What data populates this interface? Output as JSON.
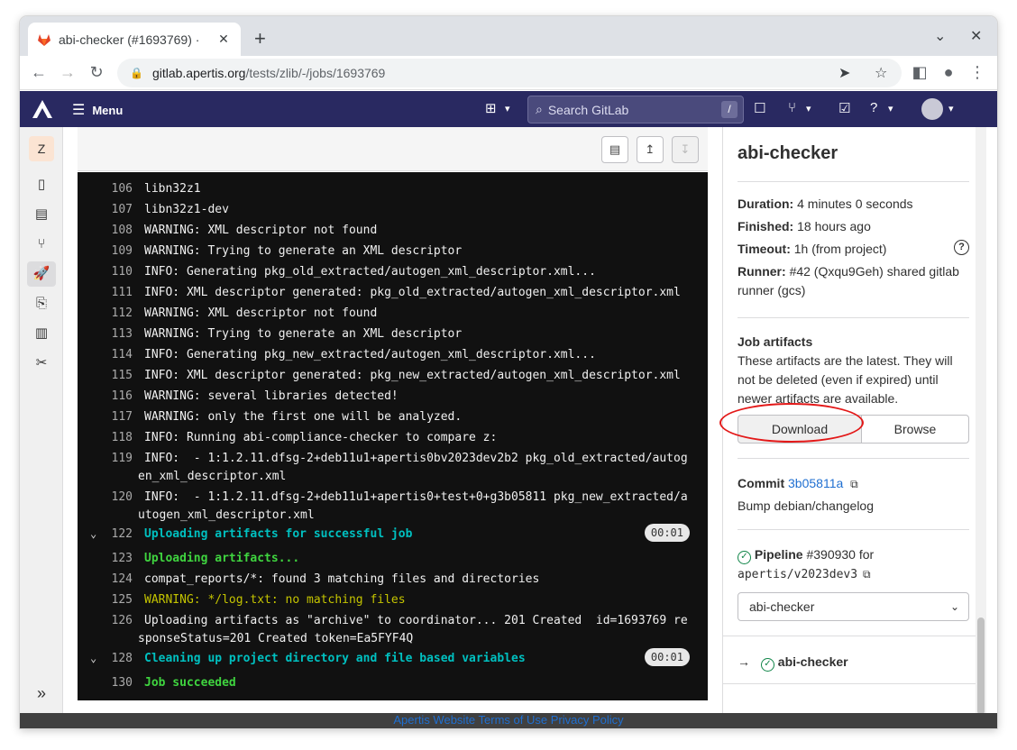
{
  "browser": {
    "tab_title": "abi-checker (#1693769) ·",
    "tab_close": "✕",
    "new_tab": "+",
    "url_host": "gitlab.apertis.org",
    "url_path": "/tests/zlib/-/jobs/1693769"
  },
  "gitlab_nav": {
    "menu_label": "Menu",
    "search_placeholder": "Search GitLab",
    "search_shortcut": "/"
  },
  "sidebar": {
    "project_letter": "Z",
    "collapse_icon": "»"
  },
  "log": {
    "lines": [
      {
        "n": "106",
        "text": "libn32z1"
      },
      {
        "n": "107",
        "text": "libn32z1-dev"
      },
      {
        "n": "108",
        "text": "WARNING: XML descriptor not found"
      },
      {
        "n": "109",
        "text": "WARNING: Trying to generate an XML descriptor"
      },
      {
        "n": "110",
        "text": "INFO: Generating pkg_old_extracted/autogen_xml_descriptor.xml..."
      },
      {
        "n": "111",
        "text": "INFO: XML descriptor generated: pkg_old_extracted/autogen_xml_descriptor.xml"
      },
      {
        "n": "112",
        "text": "WARNING: XML descriptor not found"
      },
      {
        "n": "113",
        "text": "WARNING: Trying to generate an XML descriptor"
      },
      {
        "n": "114",
        "text": "INFO: Generating pkg_new_extracted/autogen_xml_descriptor.xml..."
      },
      {
        "n": "115",
        "text": "INFO: XML descriptor generated: pkg_new_extracted/autogen_xml_descriptor.xml"
      },
      {
        "n": "116",
        "text": "WARNING: several libraries detected!"
      },
      {
        "n": "117",
        "text": "WARNING: only the first one will be analyzed."
      },
      {
        "n": "118",
        "text": "INFO: Running abi-compliance-checker to compare z:"
      },
      {
        "n": "119",
        "text": "INFO:  - 1:1.2.11.dfsg-2+deb11u1+apertis0bv2023dev2b2 pkg_old_extracted/autog",
        "cont": "en_xml_descriptor.xml"
      },
      {
        "n": "120",
        "text": "INFO:  - 1:1.2.11.dfsg-2+deb11u1+apertis0+test+0+g3b05811 pkg_new_extracted/a",
        "cont": "utogen_xml_descriptor.xml"
      },
      {
        "n": "122",
        "text": "Uploading artifacts for successful job",
        "section": true,
        "duration": "00:01"
      },
      {
        "n": "123",
        "text": "Uploading artifacts..."
      },
      {
        "n": "124",
        "text": "compat_reports/*: found 3 matching files and directories"
      },
      {
        "n": "125",
        "text": "WARNING: */log.txt: no matching files"
      },
      {
        "n": "126",
        "text": "Uploading artifacts as \"archive\" to coordinator... 201 Created  id=1693769 re",
        "cont": "sponseStatus=201 Created token=Ea5FYF4Q"
      },
      {
        "n": "128",
        "text": "Cleaning up project directory and file based variables",
        "section": true,
        "duration": "00:01"
      },
      {
        "n": "130",
        "text": "Job succeeded"
      }
    ]
  },
  "footer": {
    "text": "Apertis Website Terms of Use Privacy Policy"
  },
  "job": {
    "title": "abi-checker",
    "duration_label": "Duration:",
    "duration_value": "4 minutes 0 seconds",
    "finished_label": "Finished:",
    "finished_value": "18 hours ago",
    "timeout_label": "Timeout:",
    "timeout_value": "1h (from project)",
    "runner_label": "Runner:",
    "runner_value": "#42 (Qxqu9Geh) shared gitlab runner (gcs)",
    "artifacts_title": "Job artifacts",
    "artifacts_text": "These artifacts are the latest. They will not be deleted (even if expired) until newer artifacts are available.",
    "download_label": "Download",
    "browse_label": "Browse",
    "commit_label": "Commit",
    "commit_sha": "3b05811a",
    "commit_message": "Bump debian/changelog",
    "pipeline_label": "Pipeline",
    "pipeline_id": "#390930",
    "pipeline_for": "for",
    "pipeline_ref": "apertis/v2023dev3",
    "stage_select": "abi-checker",
    "current_job": "abi-checker"
  }
}
